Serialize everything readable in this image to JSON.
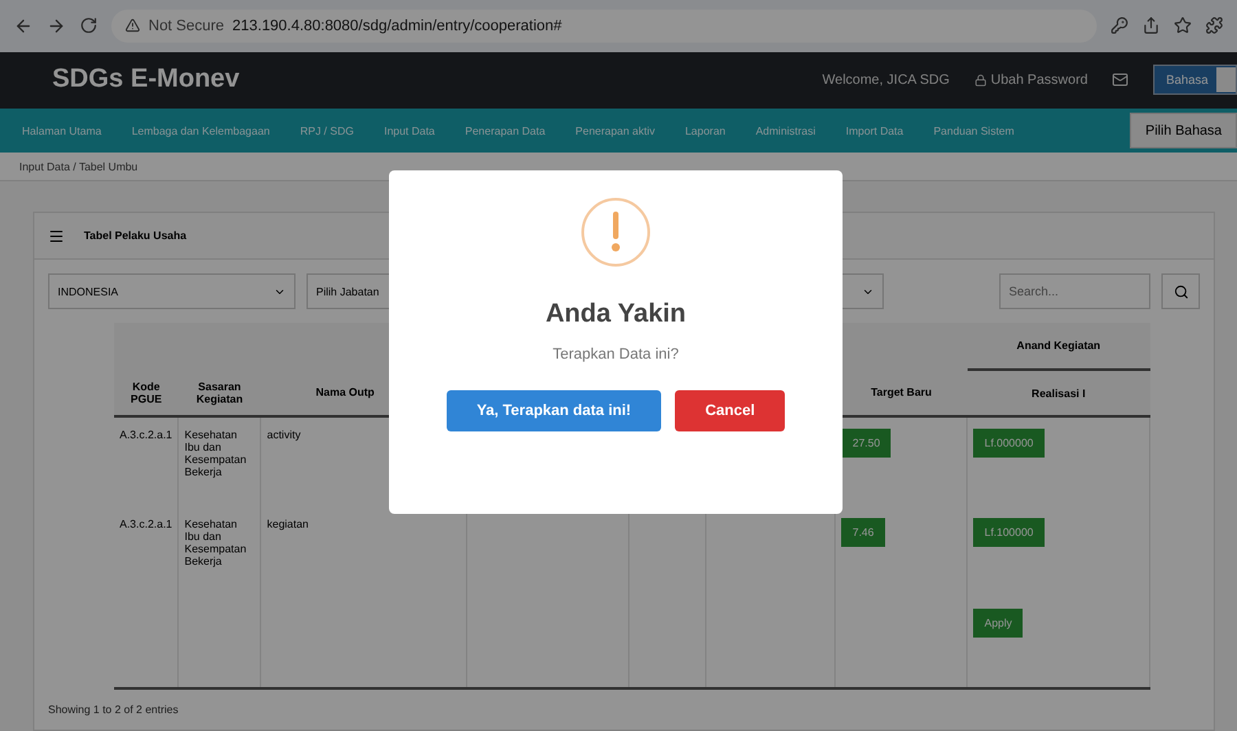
{
  "browser": {
    "security": "Not Secure",
    "url": "213.190.4.80:8080/sdg/admin/entry/cooperation#"
  },
  "app": {
    "title": "SDGs E-Monev",
    "welcome": "Welcome, JICA SDG",
    "password_link": "Ubah Password",
    "language_toggle": {
      "label": "Bahasa",
      "on": true
    }
  },
  "nav": [
    "Halaman Utama",
    "Lembaga dan Kelembagaan",
    "RPJ / SDG",
    "Input Data",
    "Penerapan Data",
    "Penerapan aktiv",
    "Laporan",
    "Administrasi",
    "Import Data",
    "Panduan Sistem"
  ],
  "nav_button": "Pilih Bahasa",
  "breadcrumb": "Input Data / Tabel Umbu",
  "panel": {
    "title": "Tabel Pelaku Usaha",
    "country": "INDONESIA",
    "position": "Pilih Jabatan",
    "search_placeholder": "Search...",
    "table": {
      "group_header": "Anand Kegiatan",
      "columns": [
        "Kode PGUE",
        "Sasaran Kegiatan",
        "Nama Outp",
        "Target Baru",
        "Realisasi I"
      ],
      "rows": [
        {
          "code": "A.3.c.2.a.1",
          "goal": "Kesehatan Ibu dan Kesempatan Bekerja",
          "output": "activity",
          "target": "27.50",
          "realisation": "Lf.000000"
        },
        {
          "code": "A.3.c.2.a.1",
          "goal": "Kesehatan Ibu dan Kesempatan Bekerja",
          "output": "kegiatan",
          "target": "7.46",
          "realisation": "Lf.100000"
        }
      ],
      "footer_button": "Apply"
    },
    "info": "Showing 1 to 2 of 2 entries"
  },
  "dialog": {
    "title": "Anda Yakin",
    "message": "Terapkan Data ini?",
    "confirm": "Ya, Terapkan data ini!",
    "cancel": "Cancel"
  }
}
